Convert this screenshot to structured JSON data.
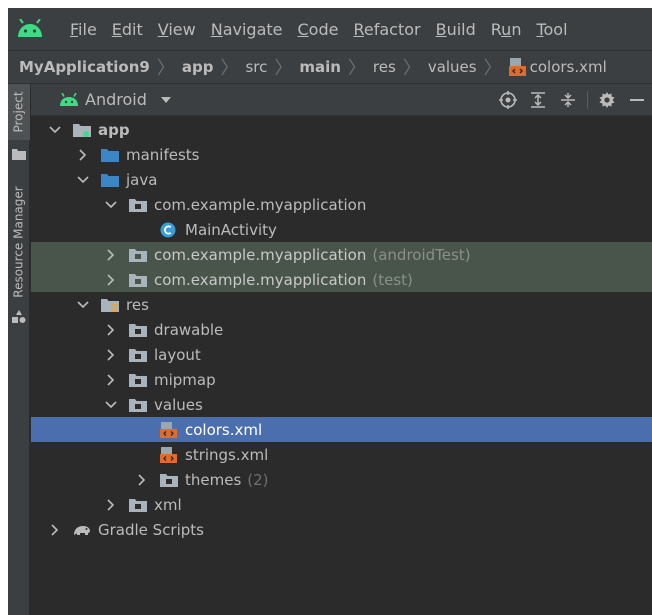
{
  "menubar": {
    "logo": "android-logo-icon",
    "items": [
      {
        "mnemonic": "F",
        "rest": "ile"
      },
      {
        "mnemonic": "E",
        "rest": "dit"
      },
      {
        "mnemonic": "V",
        "rest": "iew"
      },
      {
        "mnemonic": "N",
        "rest": "avigate"
      },
      {
        "mnemonic": "C",
        "rest": "ode"
      },
      {
        "mnemonic": "R",
        "rest": "efactor"
      },
      {
        "mnemonic": "B",
        "rest": "uild"
      },
      {
        "pre": "R",
        "mnemonic": "u",
        "rest": "n"
      },
      {
        "mnemonic": "T",
        "rest": "ool"
      }
    ]
  },
  "breadcrumb": {
    "items": [
      "MyApplication9",
      "app",
      "src",
      "main",
      "res",
      "values",
      "colors.xml"
    ]
  },
  "sidestrip": {
    "project_tab": "Project",
    "resource_tab": "Resource Manager"
  },
  "toolwindow": {
    "view_mode": "Android",
    "actions": [
      "locate-icon",
      "expand-all-icon",
      "collapse-all-icon",
      "settings-gear-icon",
      "hide-icon"
    ]
  },
  "tree": {
    "app": "app",
    "manifests": "manifests",
    "java": "java",
    "pkg_main": "com.example.myapplication",
    "main_activity": "MainActivity",
    "pkg_android_test": "com.example.myapplication",
    "pkg_android_test_suffix": "(androidTest)",
    "pkg_test": "com.example.myapplication",
    "pkg_test_suffix": "(test)",
    "res": "res",
    "drawable": "drawable",
    "layout": "layout",
    "mipmap": "mipmap",
    "values": "values",
    "colors": "colors.xml",
    "strings": "strings.xml",
    "themes": "themes",
    "themes_count": "(2)",
    "xml": "xml",
    "gradle": "Gradle Scripts"
  },
  "colors": {
    "android_green": "#3ddc84",
    "selection": "#4b6eaf",
    "test_highlight": "#49544a",
    "folder_blue": "#3d86c6",
    "folder_gray": "#a8b3bc",
    "xml_orange": "#e06b2e",
    "activity_blue": "#389fd6"
  }
}
